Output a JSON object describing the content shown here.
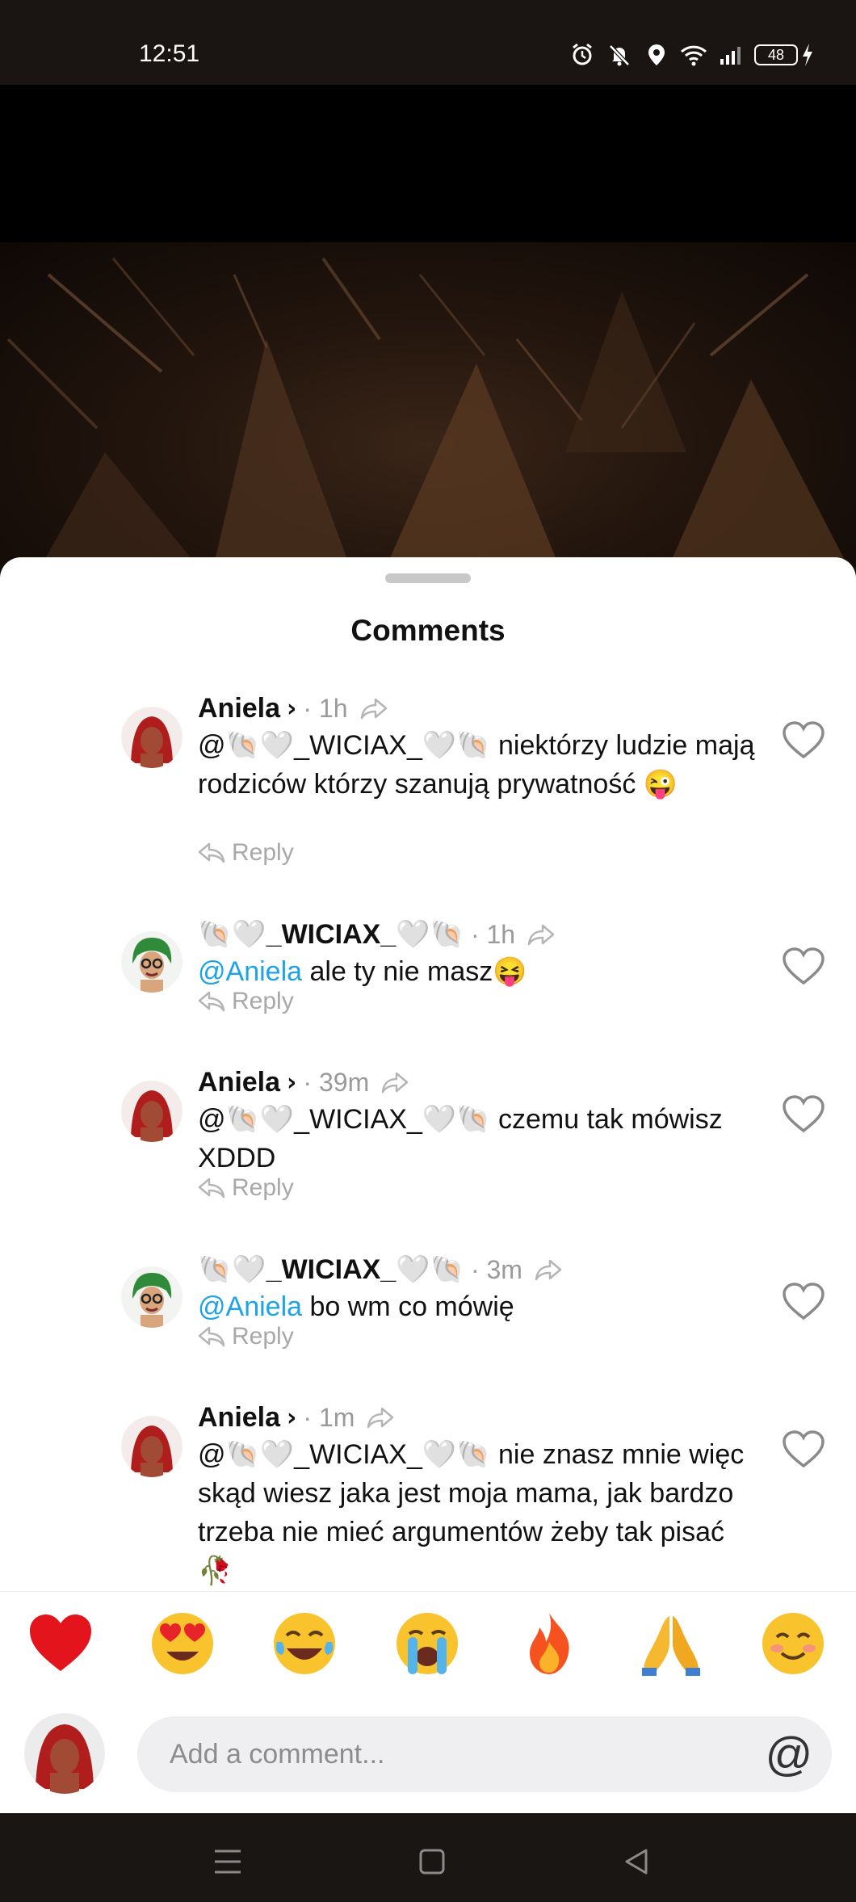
{
  "status_bar": {
    "time": "12:51",
    "battery": "48",
    "icons": [
      "alarm-icon",
      "mute-icon",
      "location-icon",
      "wifi-icon",
      "signal-icon",
      "battery-icon",
      "charging-icon"
    ]
  },
  "sheet": {
    "title": "Comments"
  },
  "comments": [
    {
      "user": "Aniela",
      "has_chevron": true,
      "time": "1h",
      "mention": "",
      "text": "@🐚🤍_WICIAX_🤍🐚 niektórzy ludzie mają rodziców którzy szanują prywatność 😜",
      "reply_label": "Reply"
    },
    {
      "user": "🐚🤍_WICIAX_🤍🐚",
      "has_chevron": false,
      "time": "1h",
      "mention": "@Aniela",
      "text": " ale ty nie masz😝",
      "reply_label": "Reply"
    },
    {
      "user": "Aniela",
      "has_chevron": true,
      "time": "39m",
      "mention": "",
      "text": "@🐚🤍_WICIAX_🤍🐚 czemu tak mówisz XDDD",
      "reply_label": "Reply"
    },
    {
      "user": "🐚🤍_WICIAX_🤍🐚",
      "has_chevron": false,
      "time": "3m",
      "mention": "@Aniela",
      "text": " bo wm co mówię",
      "reply_label": "Reply"
    },
    {
      "user": "Aniela",
      "has_chevron": true,
      "time": "1m",
      "mention": "",
      "text": "@🐚🤍_WICIAX_🤍🐚 nie znasz mnie więc skąd wiesz jaka jest moja mama, jak bardzo trzeba nie mieć argumentów żeby tak pisać 🥀",
      "reply_label": ""
    }
  ],
  "reactions": [
    "❤️",
    "😍",
    "😂",
    "😭",
    "🔥",
    "🙏",
    "😊"
  ],
  "composer": {
    "placeholder": "Add a comment...",
    "at_symbol": "@"
  },
  "colors": {
    "mention": "#1ea3e6",
    "muted": "#9a9a9a"
  }
}
